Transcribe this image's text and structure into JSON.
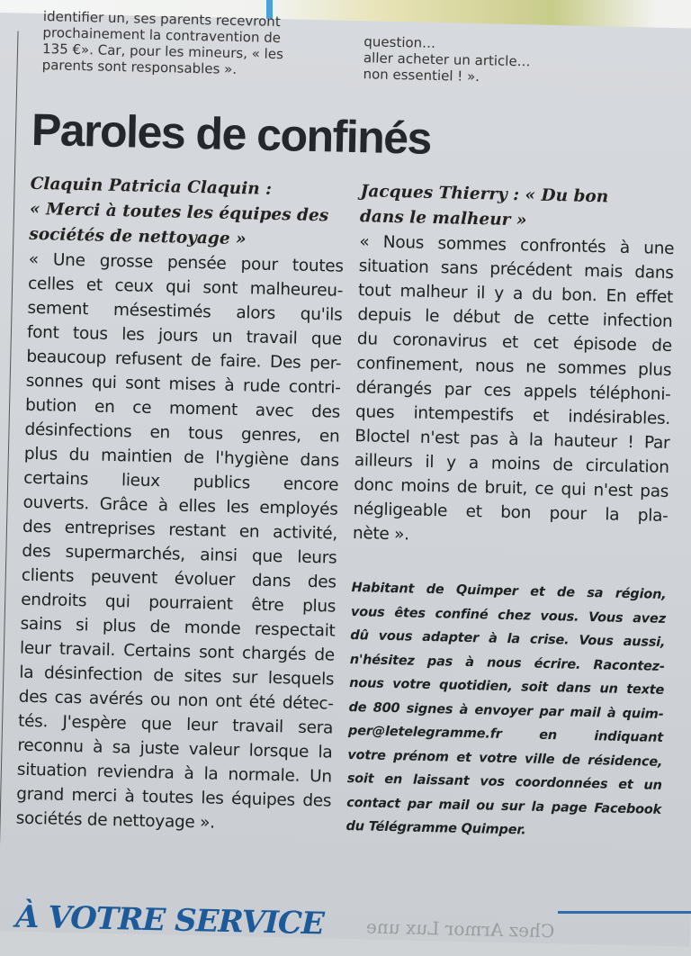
{
  "previous_article": {
    "left_lines": [
      "identifier un, ses parents recevront",
      "prochainement la contravention de",
      "135 €». Car, pour les mineurs, « les",
      "parents sont responsables »."
    ],
    "right_lines": [
      "question…",
      "aller acheter un article…",
      "non essentiel ! »."
    ]
  },
  "headline": "Paroles de confinés",
  "left_column": {
    "byline": [
      "Claquin Patricia Claquin :",
      "« Merci à toutes les équipes des",
      "sociétés de nettoyage »"
    ],
    "lines": [
      "« Une grosse pensée pour toutes",
      "celles et ceux qui sont malheureu-",
      "sement mésestimés alors qu'ils",
      "font tous les jours un travail que",
      "beaucoup refusent de faire. Des per-",
      "sonnes qui sont mises à rude contri-",
      "bution en ce moment avec des",
      "désinfections en tous genres, en",
      "plus du maintien de l'hygiène dans",
      "certains lieux publics encore",
      "ouverts. Grâce à elles les employés",
      "des entreprises restant en activité,",
      "des supermarchés, ainsi que leurs",
      "clients peuvent évoluer dans des",
      "endroits qui pourraient être plus",
      "sains si plus de monde respectait",
      "leur travail. Certains sont chargés de",
      "la désinfection de sites sur lesquels",
      "des cas avérés ou non ont été détec-",
      "tés. J'espère que leur travail sera",
      "reconnu à sa juste valeur lorsque la",
      "situation reviendra à la normale. Un",
      "grand merci à toutes les équipes des",
      "sociétés de nettoyage »."
    ]
  },
  "right_column": {
    "byline": [
      "Jacques Thierry : « Du bon",
      "dans le malheur »"
    ],
    "lines": [
      "« Nous sommes confrontés à une",
      "situation sans précédent mais dans",
      "tout malheur il y a du bon. En effet",
      "depuis le début de cette infection",
      "du coronavirus et cet épisode de",
      "confinement, nous ne sommes plus",
      "dérangés par ces appels téléphoni-",
      "ques intempestifs et indésirables.",
      "Bloctel n'est pas à la hauteur ! Par",
      "ailleurs il y a moins de circulation",
      "donc moins de bruit, ce qui n'est pas",
      "négligeable et bon pour la pla-",
      "nète »."
    ],
    "callout": [
      "Habitant de Quimper et de sa région,",
      "vous êtes confiné chez vous. Vous avez",
      "dû vous adapter à la crise. Vous aussi,",
      "n'hésitez pas à nous écrire. Racontez-",
      "nous votre quotidien, soit dans un texte",
      "de 800 signes à envoyer par mail à quim-",
      "per@letelegramme.fr en indiquant",
      "votre prénom et votre ville de résidence,",
      "soit en laissant vos coordonnées et un",
      "contact par mail ou sur la page Facebook",
      "du Télégramme Quimper."
    ]
  },
  "next_section": {
    "title": "À VOTRE SERVICE",
    "show_through_text": "Chez Armor Lux une"
  }
}
